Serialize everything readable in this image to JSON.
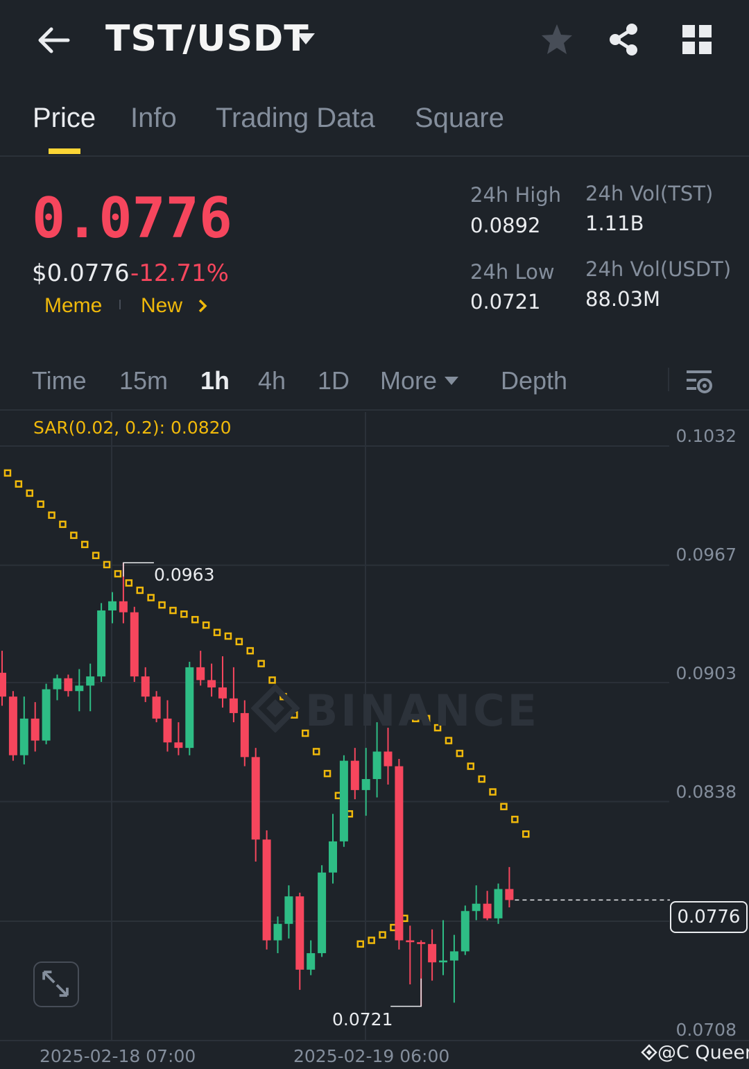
{
  "header": {
    "pair": "TST/USDT",
    "icons": [
      "back-arrow-icon",
      "caret-down-icon",
      "star-icon",
      "share-icon",
      "grid-icon"
    ]
  },
  "tabs": [
    {
      "label": "Price",
      "active": true
    },
    {
      "label": "Info",
      "active": false
    },
    {
      "label": "Trading Data",
      "active": false
    },
    {
      "label": "Square",
      "active": false
    }
  ],
  "ticker": {
    "last_price": "0.0776",
    "usd_price": "$0.0776",
    "change_pct": "-12.71%",
    "tags": [
      "Meme",
      "New"
    ],
    "stats": {
      "high_label": "24h High",
      "high_value": "0.0892",
      "low_label": "24h Low",
      "low_value": "0.0721",
      "vol_base_label": "24h Vol(TST)",
      "vol_base_value": "1.11B",
      "vol_quote_label": "24h Vol(USDT)",
      "vol_quote_value": "88.03M"
    }
  },
  "intervals": [
    {
      "label": "Time",
      "active": false
    },
    {
      "label": "15m",
      "active": false
    },
    {
      "label": "1h",
      "active": true
    },
    {
      "label": "4h",
      "active": false
    },
    {
      "label": "1D",
      "active": false
    },
    {
      "label": "More",
      "active": false
    },
    {
      "label": "Depth",
      "active": false
    }
  ],
  "colors": {
    "up": "#2ebd85",
    "down": "#f6465d",
    "sar": "#f0b90b",
    "accent": "#fcd535",
    "background": "#1e2329"
  },
  "chart_data": {
    "type": "candlestick",
    "indicator_label": "SAR(0.02, 0.2): 0.0820",
    "y_ticks": [
      "0.1032",
      "0.0967",
      "0.0903",
      "0.0838",
      "0.0776",
      "0.0708"
    ],
    "ylim": [
      0.0708,
      0.1032
    ],
    "x_ticks": [
      "2025-02-18 07:00",
      "2025-02-19 06:00"
    ],
    "last_price_label": "0.0776",
    "high_marker": "0.0963",
    "low_marker": "0.0721",
    "watermark": "BINANCE",
    "candles": [
      {
        "o": 0.0903,
        "h": 0.0915,
        "l": 0.0885,
        "c": 0.089
      },
      {
        "o": 0.089,
        "h": 0.0893,
        "l": 0.0855,
        "c": 0.0858
      },
      {
        "o": 0.0858,
        "h": 0.089,
        "l": 0.0853,
        "c": 0.0878
      },
      {
        "o": 0.0878,
        "h": 0.0887,
        "l": 0.086,
        "c": 0.0866
      },
      {
        "o": 0.0866,
        "h": 0.0897,
        "l": 0.0864,
        "c": 0.0894
      },
      {
        "o": 0.0894,
        "h": 0.0902,
        "l": 0.0888,
        "c": 0.09
      },
      {
        "o": 0.09,
        "h": 0.0902,
        "l": 0.089,
        "c": 0.0893
      },
      {
        "o": 0.0893,
        "h": 0.0905,
        "l": 0.0882,
        "c": 0.0896
      },
      {
        "o": 0.0896,
        "h": 0.0908,
        "l": 0.0882,
        "c": 0.0901
      },
      {
        "o": 0.0901,
        "h": 0.0941,
        "l": 0.0898,
        "c": 0.0937
      },
      {
        "o": 0.0937,
        "h": 0.0947,
        "l": 0.093,
        "c": 0.0942
      },
      {
        "o": 0.0942,
        "h": 0.0963,
        "l": 0.093,
        "c": 0.0936
      },
      {
        "o": 0.0936,
        "h": 0.0939,
        "l": 0.0898,
        "c": 0.0901
      },
      {
        "o": 0.0901,
        "h": 0.0906,
        "l": 0.0887,
        "c": 0.089
      },
      {
        "o": 0.089,
        "h": 0.0893,
        "l": 0.0876,
        "c": 0.0878
      },
      {
        "o": 0.0878,
        "h": 0.0888,
        "l": 0.086,
        "c": 0.0865
      },
      {
        "o": 0.0865,
        "h": 0.0876,
        "l": 0.0858,
        "c": 0.0862
      },
      {
        "o": 0.0862,
        "h": 0.0909,
        "l": 0.0858,
        "c": 0.0906
      },
      {
        "o": 0.0906,
        "h": 0.0915,
        "l": 0.0896,
        "c": 0.0899
      },
      {
        "o": 0.0899,
        "h": 0.0908,
        "l": 0.089,
        "c": 0.0895
      },
      {
        "o": 0.0895,
        "h": 0.0912,
        "l": 0.0884,
        "c": 0.0889
      },
      {
        "o": 0.0889,
        "h": 0.0906,
        "l": 0.0876,
        "c": 0.0881
      },
      {
        "o": 0.0881,
        "h": 0.0888,
        "l": 0.0852,
        "c": 0.0857
      },
      {
        "o": 0.0857,
        "h": 0.0862,
        "l": 0.08,
        "c": 0.0812
      },
      {
        "o": 0.0812,
        "h": 0.0817,
        "l": 0.0752,
        "c": 0.0757
      },
      {
        "o": 0.0757,
        "h": 0.077,
        "l": 0.075,
        "c": 0.0766
      },
      {
        "o": 0.0766,
        "h": 0.0787,
        "l": 0.0758,
        "c": 0.0781
      },
      {
        "o": 0.0781,
        "h": 0.0783,
        "l": 0.073,
        "c": 0.0741
      },
      {
        "o": 0.0741,
        "h": 0.0757,
        "l": 0.0738,
        "c": 0.075
      },
      {
        "o": 0.075,
        "h": 0.0798,
        "l": 0.0748,
        "c": 0.0794
      },
      {
        "o": 0.0794,
        "h": 0.0826,
        "l": 0.0788,
        "c": 0.0811
      },
      {
        "o": 0.0811,
        "h": 0.0858,
        "l": 0.0808,
        "c": 0.0855
      },
      {
        "o": 0.0855,
        "h": 0.0862,
        "l": 0.0834,
        "c": 0.0839
      },
      {
        "o": 0.0839,
        "h": 0.0862,
        "l": 0.0825,
        "c": 0.0845
      },
      {
        "o": 0.0845,
        "h": 0.0876,
        "l": 0.0835,
        "c": 0.086
      },
      {
        "o": 0.086,
        "h": 0.0873,
        "l": 0.0842,
        "c": 0.0852
      },
      {
        "o": 0.0852,
        "h": 0.0856,
        "l": 0.0752,
        "c": 0.0757
      },
      {
        "o": 0.0757,
        "h": 0.0765,
        "l": 0.0733,
        "c": 0.0756
      },
      {
        "o": 0.0756,
        "h": 0.0757,
        "l": 0.0721,
        "c": 0.0755
      },
      {
        "o": 0.0755,
        "h": 0.0763,
        "l": 0.0735,
        "c": 0.0745
      },
      {
        "o": 0.0745,
        "h": 0.0768,
        "l": 0.0738,
        "c": 0.0746
      },
      {
        "o": 0.0746,
        "h": 0.076,
        "l": 0.0723,
        "c": 0.0751
      },
      {
        "o": 0.0751,
        "h": 0.0776,
        "l": 0.0749,
        "c": 0.0773
      },
      {
        "o": 0.0773,
        "h": 0.0787,
        "l": 0.0768,
        "c": 0.0777
      },
      {
        "o": 0.0777,
        "h": 0.0784,
        "l": 0.0768,
        "c": 0.0769
      },
      {
        "o": 0.0769,
        "h": 0.0788,
        "l": 0.0766,
        "c": 0.0785
      },
      {
        "o": 0.0785,
        "h": 0.0797,
        "l": 0.0775,
        "c": 0.0779
      }
    ],
    "sar": [
      0.1012,
      0.1006,
      0.1001,
      0.0995,
      0.0989,
      0.0984,
      0.0978,
      0.0973,
      0.0967,
      0.0962,
      0.0957,
      0.0952,
      0.0948,
      0.0944,
      0.094,
      0.0937,
      0.0935,
      0.0932,
      0.0929,
      0.0925,
      0.0923,
      0.092,
      0.0915,
      0.0908,
      0.0899,
      0.089,
      0.088,
      0.087,
      0.086,
      0.0848,
      0.0836,
      0.0826,
      0.0755,
      0.0757,
      0.076,
      0.0764,
      0.0769,
      0.0878,
      0.0878,
      0.0873,
      0.0866,
      0.0859,
      0.0852,
      0.0845,
      0.0838,
      0.083,
      0.0823,
      0.0815
    ]
  },
  "credit": "@C Queen"
}
